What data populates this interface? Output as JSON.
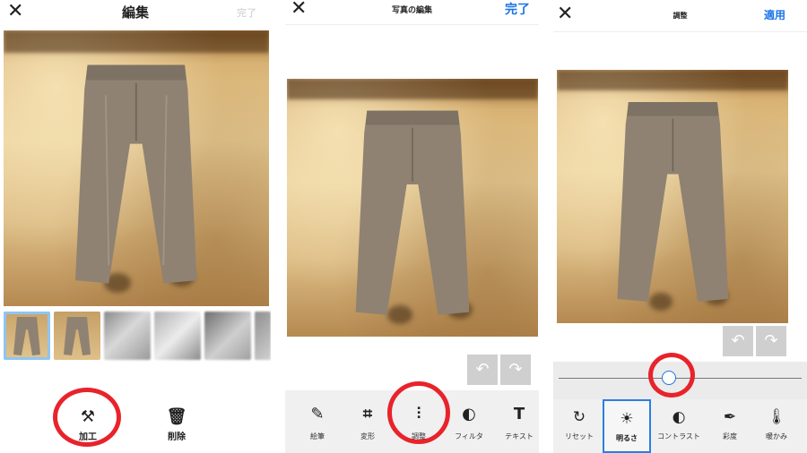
{
  "panel1": {
    "title": "編集",
    "done_label": "完了",
    "actions": [
      {
        "label": "加工",
        "icon": "magic-wand-icon"
      },
      {
        "label": "削除",
        "icon": "trash-icon"
      }
    ]
  },
  "panel2": {
    "title": "写真の編集",
    "done_label": "完了",
    "tools": [
      {
        "label": "絵筆",
        "icon": "brush-icon"
      },
      {
        "label": "変形",
        "icon": "crop-icon"
      },
      {
        "label": "調整",
        "icon": "sliders-icon"
      },
      {
        "label": "フィルタ",
        "icon": "filter-icon"
      },
      {
        "label": "テキスト",
        "icon": "text-icon"
      }
    ]
  },
  "panel3": {
    "title": "調整",
    "apply_label": "適用",
    "adjustments": [
      {
        "label": "リセット",
        "icon": "reset-icon"
      },
      {
        "label": "明るさ",
        "icon": "sun-icon"
      },
      {
        "label": "コントラスト",
        "icon": "contrast-icon"
      },
      {
        "label": "彩度",
        "icon": "dropper-icon"
      },
      {
        "label": "暖かみ",
        "icon": "thermometer-icon"
      }
    ]
  },
  "colors": {
    "accent": "#1a73e8",
    "highlight": "#e8232b"
  }
}
